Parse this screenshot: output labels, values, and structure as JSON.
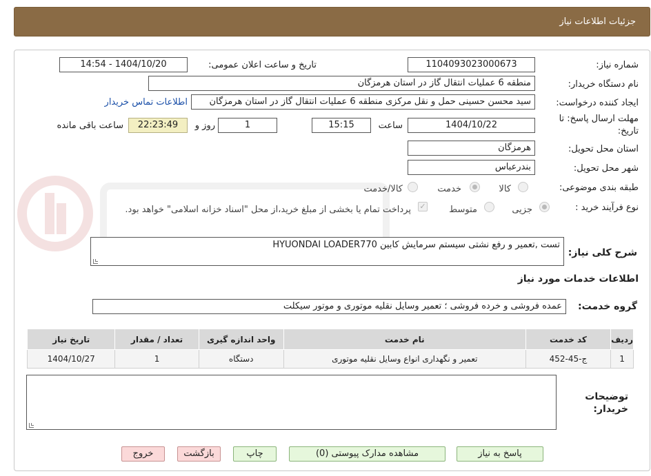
{
  "header": {
    "title": "جزئیات اطلاعات نیاز"
  },
  "form": {
    "need_number_label": "شماره نیاز:",
    "need_number": "1104093023000673",
    "announce_label": "تاریخ و ساعت اعلان عمومی:",
    "announce_value": "1404/10/20 - 14:54",
    "buyer_org_label": "نام دستگاه خریدار:",
    "buyer_org": "منطقه 6 عملیات انتقال گاز در استان هرمزگان",
    "requester_label": "ایجاد کننده درخواست:",
    "requester": "سید محسن حسینی حمل و نقل مرکزی منطقه 6 عملیات انتقال گاز در استان هرمزگان",
    "contact_link": "اطلاعات تماس خریدار",
    "deadline_label_1": "مهلت ارسال پاسخ: تا",
    "deadline_label_2": "تاریخ:",
    "deadline_date": "1404/10/22",
    "time_label": "ساعت",
    "deadline_time": "15:15",
    "days_value": "1",
    "days_label": "روز و",
    "time_left": "22:23:49",
    "time_left_label": "ساعت باقی مانده",
    "province_label": "استان محل تحویل:",
    "province": "هرمزگان",
    "city_label": "شهر محل تحویل:",
    "city": "بندرعباس",
    "category_label": "طبقه بندی موضوعی:",
    "category_options": [
      "کالا",
      "خدمت",
      "کالا/خدمت"
    ],
    "category_selected": "خدمت",
    "process_label": "نوع فرآیند خرید :",
    "process_options": [
      "جزیی",
      "متوسط"
    ],
    "process_selected": "جزیی",
    "payment_note": "پرداخت تمام یا بخشی از مبلغ خرید،از محل \"اسناد خزانه اسلامی\" خواهد بود.",
    "description_label": "شرح کلی نیاز:",
    "description": "تست ,تعمیر و رفع نشتی سیستم سرمایش کابین HYUONDAI LOADER770"
  },
  "services": {
    "section_title": "اطلاعات خدمات مورد نیاز",
    "group_label": "گروه خدمت:",
    "group_value": "عمده فروشی و خرده فروشی ؛ تعمیر وسایل نقلیه موتوری و موتور سیکلت",
    "columns": [
      "ردیف",
      "کد خدمت",
      "نام خدمت",
      "واحد اندازه گیری",
      "تعداد / مقدار",
      "تاریخ نیاز"
    ],
    "rows": [
      [
        "1",
        "ج-45-452",
        "تعمیر و نگهداری انواع وسایل نقلیه موتوری",
        "دستگاه",
        "1",
        "1404/10/27"
      ]
    ]
  },
  "buyer_notes": {
    "label_1": "توضیحات",
    "label_2": "خریدار:",
    "value": ""
  },
  "buttons": {
    "reply": "پاسخ به نیاز",
    "attachments": "مشاهده مدارک پیوستی (0)",
    "print": "چاپ",
    "back": "بازگشت",
    "exit": "خروج"
  }
}
